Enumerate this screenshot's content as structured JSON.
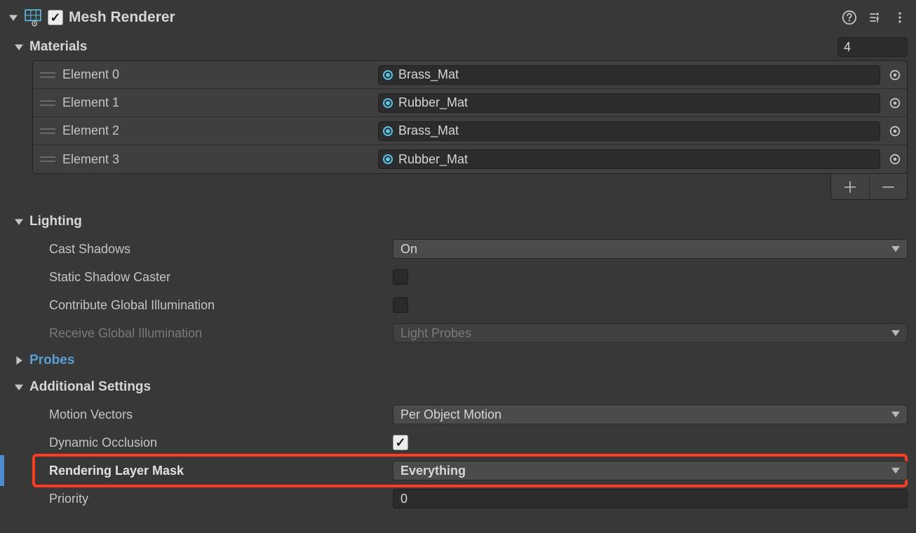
{
  "header": {
    "title": "Mesh Renderer",
    "enabled": true
  },
  "materials": {
    "label": "Materials",
    "count": "4",
    "elements": [
      {
        "label": "Element 0",
        "value": "Brass_Mat"
      },
      {
        "label": "Element 1",
        "value": "Rubber_Mat"
      },
      {
        "label": "Element 2",
        "value": "Brass_Mat"
      },
      {
        "label": "Element 3",
        "value": "Rubber_Mat"
      }
    ]
  },
  "lighting": {
    "label": "Lighting",
    "castShadows": {
      "label": "Cast Shadows",
      "value": "On"
    },
    "staticShadowCaster": {
      "label": "Static Shadow Caster",
      "checked": false
    },
    "contributeGI": {
      "label": "Contribute Global Illumination",
      "checked": false
    },
    "receiveGI": {
      "label": "Receive Global Illumination",
      "value": "Light Probes",
      "disabled": true
    }
  },
  "probes": {
    "label": "Probes"
  },
  "additional": {
    "label": "Additional Settings",
    "motionVectors": {
      "label": "Motion Vectors",
      "value": "Per Object Motion"
    },
    "dynamicOcclusion": {
      "label": "Dynamic Occlusion",
      "checked": true
    },
    "renderingLayerMask": {
      "label": "Rendering Layer Mask",
      "value": "Everything"
    },
    "priority": {
      "label": "Priority",
      "value": "0"
    }
  }
}
